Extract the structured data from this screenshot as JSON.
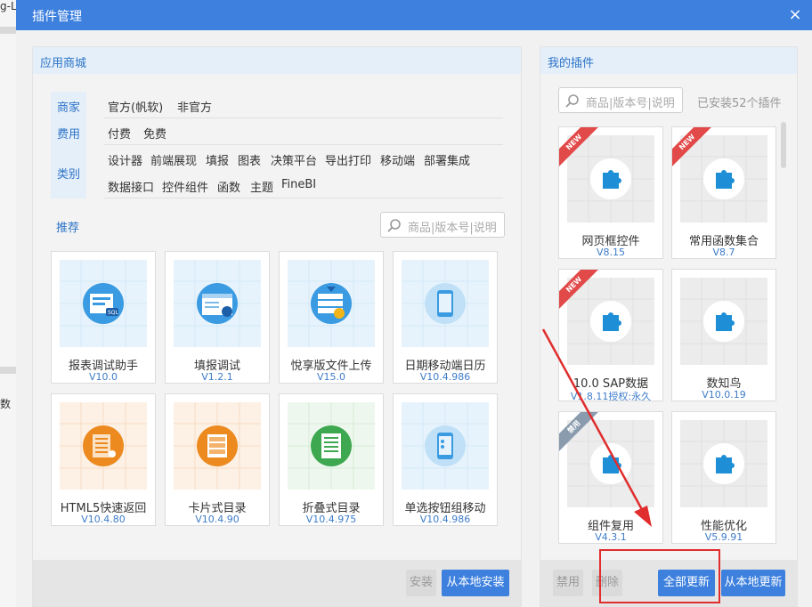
{
  "background": {
    "fragments": [
      "g-L",
      "数"
    ]
  },
  "dialog": {
    "title": "插件管理",
    "close_glyph": "×",
    "accent_color": "#3d80de"
  },
  "store": {
    "header": "应用商城",
    "filters": {
      "labels": {
        "vendor": "商家",
        "fee": "费用",
        "category": "类别"
      },
      "vendor": [
        "官方(帆软)",
        "非官方"
      ],
      "fee": [
        "付费",
        "免费"
      ],
      "category_row1": [
        "设计器",
        "前端展现",
        "填报",
        "图表",
        "决策平台",
        "导出打印",
        "移动端",
        "部署集成"
      ],
      "category_row2": [
        "数据接口",
        "控件组件",
        "函数",
        "主题",
        "FineBI"
      ]
    },
    "recommend_label": "推荐",
    "search_placeholder": "商品|版本号|说明",
    "cards": [
      {
        "name": "报表调试助手",
        "version": "V10.0",
        "theme": "blue",
        "icon_name": "report-debug-icon"
      },
      {
        "name": "填报调试",
        "version": "V1.2.1",
        "theme": "blue",
        "icon_name": "fill-debug-icon"
      },
      {
        "name": "悅享版文件上传",
        "version": "V15.0",
        "theme": "blue",
        "icon_name": "file-upload-icon"
      },
      {
        "name": "日期移动端日历",
        "version": "V10.4.986",
        "theme": "blue",
        "icon_name": "mobile-calendar-icon"
      },
      {
        "name": "HTML5快速返回",
        "version": "V10.4.80",
        "theme": "orange",
        "icon_name": "html5-back-icon"
      },
      {
        "name": "卡片式目录",
        "version": "V10.4.90",
        "theme": "orange",
        "icon_name": "card-catalog-icon"
      },
      {
        "name": "折叠式目录",
        "version": "V10.4.975",
        "theme": "green",
        "icon_name": "fold-catalog-icon"
      },
      {
        "name": "单选按钮组移动",
        "version": "V10.4.986",
        "theme": "blue",
        "icon_name": "radio-mobile-icon"
      }
    ],
    "install_button": "安装",
    "local_install_button": "从本地安装"
  },
  "mine": {
    "header": "我的插件",
    "search_placeholder": "商品|版本号|说明",
    "installed_count": "已安装52个插件",
    "cards": [
      {
        "name": "网页框控件",
        "version": "V8.15",
        "badge": "NEW"
      },
      {
        "name": "常用函数集合",
        "version": "V8.7",
        "badge": "NEW"
      },
      {
        "name": "10.0 SAP数据",
        "version": "V1.8.11授权:永久",
        "badge": "NEW"
      },
      {
        "name": "数知鸟",
        "version": "V10.0.19",
        "badge": ""
      },
      {
        "name": "组件复用",
        "version": "V4.3.1",
        "badge": "禁用"
      },
      {
        "name": "性能优化",
        "version": "V5.9.91",
        "badge": ""
      }
    ],
    "buttons": {
      "disable": "禁用",
      "delete": "删除",
      "update_all": "全部更新",
      "update_local": "从本地更新"
    }
  },
  "colors": {
    "accent": "#3d80de",
    "link": "#2c73c8",
    "annotation": "#e02d2d",
    "new_badge": "#e24a4a",
    "puzzle": "#1e8fd6"
  }
}
